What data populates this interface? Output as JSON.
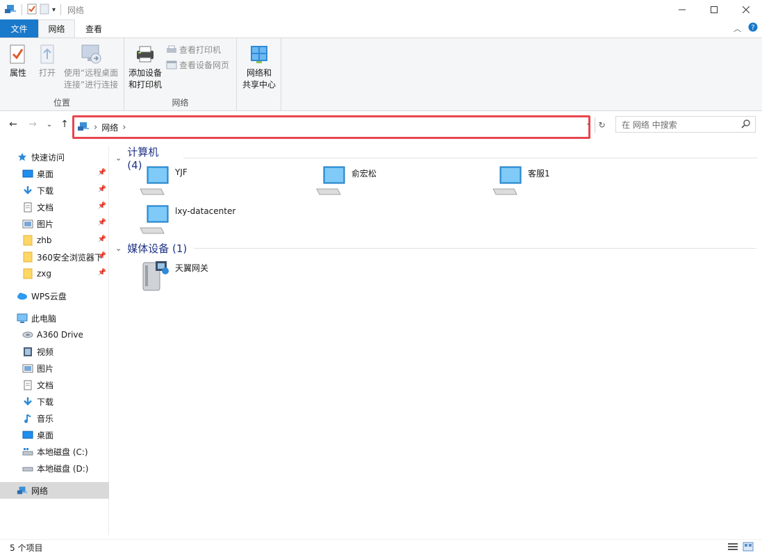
{
  "window": {
    "title": "网络"
  },
  "ribbon": {
    "tabs": [
      {
        "label": "文件"
      },
      {
        "label": "网络"
      },
      {
        "label": "查看"
      }
    ],
    "groups": {
      "location": {
        "label": "位置",
        "properties": "属性",
        "open": "打开",
        "remote_line1": "使用“远程桌面",
        "remote_line2": "连接”进行连接"
      },
      "network": {
        "label": "网络",
        "add_line1": "添加设备",
        "add_line2": "和打印机",
        "view_printers": "查看打印机",
        "view_device_page": "查看设备网页"
      },
      "sharing": {
        "line1": "网络和",
        "line2": "共享中心"
      }
    }
  },
  "address": {
    "path": [
      "网络"
    ]
  },
  "search": {
    "placeholder": "在 网络 中搜索"
  },
  "sidebar": {
    "quick_access": "快速访问",
    "quick_items": [
      {
        "label": "桌面",
        "icon": "desktop-icon"
      },
      {
        "label": "下载",
        "icon": "download-icon"
      },
      {
        "label": "文档",
        "icon": "document-icon"
      },
      {
        "label": "图片",
        "icon": "picture-icon"
      },
      {
        "label": "zhb",
        "icon": "folder-icon"
      },
      {
        "label": "360安全浏览器下",
        "icon": "folder-icon"
      },
      {
        "label": "zxg",
        "icon": "folder-icon"
      }
    ],
    "wps": "WPS云盘",
    "this_pc": "此电脑",
    "pc_items": [
      {
        "label": "A360 Drive",
        "icon": "cloud-drive-icon"
      },
      {
        "label": "视频",
        "icon": "video-icon"
      },
      {
        "label": "图片",
        "icon": "picture-icon"
      },
      {
        "label": "文档",
        "icon": "document-icon"
      },
      {
        "label": "下载",
        "icon": "download-icon"
      },
      {
        "label": "音乐",
        "icon": "music-icon"
      },
      {
        "label": "桌面",
        "icon": "desktop-icon"
      },
      {
        "label": "本地磁盘 (C:)",
        "icon": "drive-c-icon"
      },
      {
        "label": "本地磁盘 (D:)",
        "icon": "drive-d-icon"
      }
    ],
    "network": "网络"
  },
  "content": {
    "computers_header": "计算机 (4)",
    "computers": [
      "YJF",
      "俞宏松",
      "客服1",
      "lxy-datacenter"
    ],
    "media_header": "媒体设备 (1)",
    "media": [
      "天翼网关"
    ]
  },
  "status": {
    "count": "5 个项目"
  },
  "colors": {
    "accent": "#1979ca",
    "highlight_border": "#e8464d",
    "group_header": "#1e3287"
  }
}
